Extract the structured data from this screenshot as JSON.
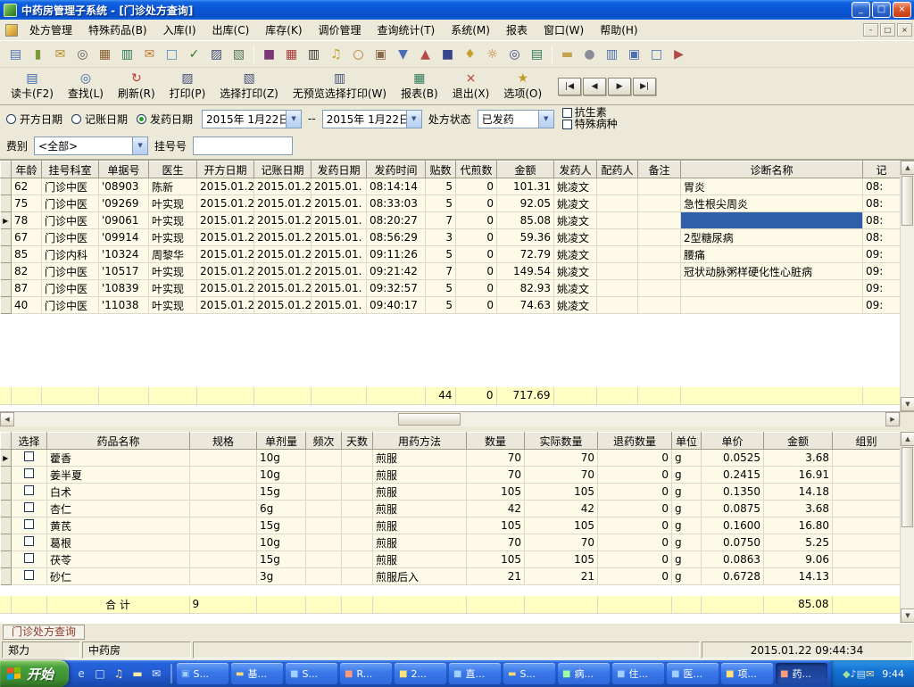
{
  "colors": {
    "titlebar_blue": "#0A56D8",
    "selection_blue": "#2E5FA8",
    "grid_row_bg": "#FDFBE7",
    "totals_row_bg": "#FFFFC4",
    "chrome_bg": "#ECE9D8",
    "taskbar_blue": "#2159CF",
    "start_green": "#3E8F33"
  },
  "window": {
    "title": "中药房管理子系统 - [门诊处方查询]",
    "controls": {
      "minimize": "_",
      "restore": "□",
      "close": "×"
    }
  },
  "menu": {
    "items": [
      "处方管理",
      "特殊药品(B)",
      "入库(I)",
      "出库(C)",
      "库存(K)",
      "调价管理",
      "查询统计(T)",
      "系统(M)",
      "报表",
      "窗口(W)",
      "帮助(H)"
    ],
    "mdi_controls": {
      "minimize": "–",
      "restore": "□",
      "close": "×"
    }
  },
  "toolbar1": [
    {
      "name": "card-scan",
      "glyph": "▤",
      "color": "#4A6FB5"
    },
    {
      "name": "medicine-vial",
      "glyph": "▮",
      "color": "#7A9A3A"
    },
    {
      "name": "mail-send",
      "glyph": "✉",
      "color": "#B5862A"
    },
    {
      "name": "binoculars",
      "glyph": "◎",
      "color": "#5A5A5A"
    },
    {
      "name": "abacus",
      "glyph": "▦",
      "color": "#8A5A2A"
    },
    {
      "name": "ledger-book",
      "glyph": "▥",
      "color": "#2E7A5A"
    },
    {
      "name": "mail-receive",
      "glyph": "✉",
      "color": "#C2762A"
    },
    {
      "name": "document-new",
      "glyph": "□",
      "color": "#4A8AC2"
    },
    {
      "name": "document-check",
      "glyph": "✓",
      "color": "#2A7A2A"
    },
    {
      "name": "printer",
      "glyph": "▨",
      "color": "#44507A"
    },
    {
      "name": "document-print",
      "glyph": "▧",
      "color": "#557755"
    },
    {
      "sep": true
    },
    {
      "name": "chart-report",
      "glyph": "■",
      "color": "#7A3A7A"
    },
    {
      "name": "calendar",
      "glyph": "▦",
      "color": "#AA3A3A"
    },
    {
      "name": "barcode",
      "glyph": "▥",
      "color": "#333333"
    },
    {
      "name": "alarm-bell",
      "glyph": "♫",
      "color": "#C2A22A"
    },
    {
      "name": "clock",
      "glyph": "○",
      "color": "#B5762A"
    },
    {
      "name": "medicine-box",
      "glyph": "▣",
      "color": "#8A6A4A"
    },
    {
      "name": "stock-in",
      "glyph": "▼",
      "color": "#4A6FB5"
    },
    {
      "name": "stock-out",
      "glyph": "▲",
      "color": "#B54A4A"
    },
    {
      "name": "save",
      "glyph": "■",
      "color": "#34458A"
    },
    {
      "name": "key",
      "glyph": "♦",
      "color": "#C2A22A"
    },
    {
      "name": "flashlight",
      "glyph": "☼",
      "color": "#C2762A"
    },
    {
      "name": "magnifier",
      "glyph": "◎",
      "color": "#34458A"
    },
    {
      "name": "checklist",
      "glyph": "▤",
      "color": "#2E7A5A"
    },
    {
      "sep": true
    },
    {
      "name": "folder-open",
      "glyph": "▬",
      "color": "#C2A24A"
    },
    {
      "name": "cd-disc",
      "glyph": "●",
      "color": "#8A8A98"
    },
    {
      "name": "window-tile",
      "glyph": "▥",
      "color": "#4A6FB5"
    },
    {
      "name": "window-cascade",
      "glyph": "▣",
      "color": "#4A6FB5"
    },
    {
      "name": "window-new",
      "glyph": "□",
      "color": "#4A6FB5"
    },
    {
      "name": "exit-app",
      "glyph": "▶",
      "color": "#B54A4A"
    }
  ],
  "toolbar2": {
    "buttons": [
      {
        "name": "read-card",
        "label": "读卡(F2)",
        "glyph": "▤",
        "color": "#3A66B0"
      },
      {
        "name": "find",
        "label": "查找(L)",
        "glyph": "◎",
        "color": "#3A66B0"
      },
      {
        "name": "refresh",
        "label": "刷新(R)",
        "glyph": "↻",
        "color": "#C03A2E"
      },
      {
        "name": "print",
        "label": "打印(P)",
        "glyph": "▨",
        "color": "#44507A"
      },
      {
        "name": "select-print",
        "label": "选择打印(Z)",
        "glyph": "▧",
        "color": "#44507A"
      },
      {
        "name": "no-preview-select-print",
        "label": "无预览选择打印(W)",
        "glyph": "▥",
        "color": "#44507A"
      },
      {
        "name": "report",
        "label": "报表(B)",
        "glyph": "▦",
        "color": "#2E7A5A"
      },
      {
        "name": "exit",
        "label": "退出(X)",
        "glyph": "×",
        "color": "#C03A2E"
      },
      {
        "name": "options",
        "label": "选项(O)",
        "glyph": "★",
        "color": "#C09A2E"
      }
    ],
    "nav": [
      {
        "name": "first-record",
        "glyph": "|◀"
      },
      {
        "name": "prev-record",
        "glyph": "◀"
      },
      {
        "name": "next-record",
        "glyph": "▶"
      },
      {
        "name": "last-record",
        "glyph": "▶|"
      }
    ]
  },
  "filters": {
    "radios": [
      {
        "label": "开方日期",
        "selected": false
      },
      {
        "label": "记账日期",
        "selected": false
      },
      {
        "label": "发药日期",
        "selected": true
      }
    ],
    "date_from": "2015年 1月22日",
    "range_separator": "--",
    "date_to": "2015年 1月22日",
    "status_label": "处方状态",
    "status_value": "已发药",
    "checkbox_antibiotic": "抗生素",
    "checkbox_special": "特殊病种",
    "fee_label": "费别",
    "fee_value": "<全部>",
    "reg_label": "挂号号",
    "reg_value": ""
  },
  "main_table": {
    "columns": [
      "年龄",
      "挂号科室",
      "单据号",
      "医生",
      "开方日期",
      "记账日期",
      "发药日期",
      "发药时间",
      "贴数",
      "代煎数",
      "金额",
      "发药人",
      "配药人",
      "备注",
      "诊断名称",
      "记"
    ],
    "rows": [
      [
        "62",
        "门诊中医",
        "'08903",
        "陈新",
        "2015.01.2",
        "2015.01.2",
        "2015.01.",
        "08:14:14",
        "5",
        "0",
        "101.31",
        "姚凌文",
        "",
        "",
        "胃炎",
        "08:"
      ],
      [
        "75",
        "门诊中医",
        "'09269",
        "叶实现",
        "2015.01.2",
        "2015.01.2",
        "2015.01.",
        "08:33:03",
        "5",
        "0",
        "92.05",
        "姚凌文",
        "",
        "",
        "急性根尖周炎",
        "08:"
      ],
      [
        "78",
        "门诊中医",
        "'09061",
        "叶实现",
        "2015.01.2",
        "2015.01.2",
        "2015.01.",
        "08:20:27",
        "7",
        "0",
        "85.08",
        "姚凌文",
        "",
        "",
        "",
        "08:"
      ],
      [
        "67",
        "门诊中医",
        "'09914",
        "叶实现",
        "2015.01.2",
        "2015.01.2",
        "2015.01.",
        "08:56:29",
        "3",
        "0",
        "59.36",
        "姚凌文",
        "",
        "",
        "2型糖尿病",
        "08:"
      ],
      [
        "85",
        "门诊内科",
        "'10324",
        "周黎华",
        "2015.01.2",
        "2015.01.2",
        "2015.01.",
        "09:11:26",
        "5",
        "0",
        "72.79",
        "姚凌文",
        "",
        "",
        "腰痛",
        "09:"
      ],
      [
        "82",
        "门诊中医",
        "'10517",
        "叶实现",
        "2015.01.2",
        "2015.01.2",
        "2015.01.",
        "09:21:42",
        "7",
        "0",
        "149.54",
        "姚凌文",
        "",
        "",
        "冠状动脉粥样硬化性心脏病",
        "09:"
      ],
      [
        "87",
        "门诊中医",
        "'10839",
        "叶实现",
        "2015.01.2",
        "2015.01.2",
        "2015.01.",
        "09:32:57",
        "5",
        "0",
        "82.93",
        "姚凌文",
        "",
        "",
        "",
        "09:"
      ],
      [
        "40",
        "门诊中医",
        "'11038",
        "叶实现",
        "2015.01.2",
        "2015.01.2",
        "2015.01.",
        "09:40:17",
        "5",
        "0",
        "74.63",
        "姚凌文",
        "",
        "",
        "",
        "09:"
      ]
    ],
    "totals": {
      "tie_count": "44",
      "daijian_count": "0",
      "amount": "717.69"
    }
  },
  "detail_table": {
    "columns": [
      "选择",
      "药品名称",
      "规格",
      "单剂量",
      "频次",
      "天数",
      "用药方法",
      "数量",
      "实际数量",
      "退药数量",
      "单位",
      "单价",
      "金额",
      "组别"
    ],
    "rows": [
      [
        "",
        "藿香",
        "",
        "10g",
        "",
        "",
        "煎服",
        "70",
        "70",
        "0",
        "g",
        "0.0525",
        "3.68",
        ""
      ],
      [
        "",
        "姜半夏",
        "",
        "10g",
        "",
        "",
        "煎服",
        "70",
        "70",
        "0",
        "g",
        "0.2415",
        "16.91",
        ""
      ],
      [
        "",
        "白术",
        "",
        "15g",
        "",
        "",
        "煎服",
        "105",
        "105",
        "0",
        "g",
        "0.1350",
        "14.18",
        ""
      ],
      [
        "",
        "杏仁",
        "",
        "6g",
        "",
        "",
        "煎服",
        "42",
        "42",
        "0",
        "g",
        "0.0875",
        "3.68",
        ""
      ],
      [
        "",
        "黄芪",
        "",
        "15g",
        "",
        "",
        "煎服",
        "105",
        "105",
        "0",
        "g",
        "0.1600",
        "16.80",
        ""
      ],
      [
        "",
        "葛根",
        "",
        "10g",
        "",
        "",
        "煎服",
        "70",
        "70",
        "0",
        "g",
        "0.0750",
        "5.25",
        ""
      ],
      [
        "",
        "茯苓",
        "",
        "15g",
        "",
        "",
        "煎服",
        "105",
        "105",
        "0",
        "g",
        "0.0863",
        "9.06",
        ""
      ],
      [
        "",
        "砂仁",
        "",
        "3g",
        "",
        "",
        "煎服后入",
        "21",
        "21",
        "0",
        "g",
        "0.6728",
        "14.13",
        ""
      ]
    ],
    "total": {
      "label": "合  计",
      "dose_total": "9",
      "amount": "85.08"
    }
  },
  "doc_tab": "门诊处方查询",
  "statusbar": {
    "user": "郑力",
    "department": "中药房",
    "middle": "",
    "datetime": "2015.01.22 09:44:34"
  },
  "taskbar": {
    "start_label": "开始",
    "quick_launch": [
      {
        "name": "internet-explorer",
        "glyph": "e",
        "color": "#BFE3FF"
      },
      {
        "name": "show-desktop",
        "glyph": "□",
        "color": "#D8E8FF"
      },
      {
        "name": "media-player",
        "glyph": "♫",
        "color": "#FFD9A0"
      },
      {
        "name": "folder-docs",
        "glyph": "▬",
        "color": "#FFE9A0"
      },
      {
        "name": "mail",
        "glyph": "✉",
        "color": "#E8F0FF"
      }
    ],
    "tasks": [
      {
        "label": "S...",
        "glyph": "▣",
        "color": "#9FD0FF",
        "active": false
      },
      {
        "label": "基...",
        "glyph": "▬",
        "color": "#FFD97A",
        "active": false
      },
      {
        "label": "S...",
        "glyph": "■",
        "color": "#9FD0FF",
        "active": false
      },
      {
        "label": "R...",
        "glyph": "■",
        "color": "#FF9A7A",
        "active": false
      },
      {
        "label": "2...",
        "glyph": "■",
        "color": "#FFE07A",
        "active": false
      },
      {
        "label": "直...",
        "glyph": "■",
        "color": "#9FD0FF",
        "active": false
      },
      {
        "label": "S...",
        "glyph": "▬",
        "color": "#FFD97A",
        "active": false
      },
      {
        "label": "病...",
        "glyph": "■",
        "color": "#9FFFA0",
        "active": false
      },
      {
        "label": "住...",
        "glyph": "■",
        "color": "#9FD0FF",
        "active": false
      },
      {
        "label": "医...",
        "glyph": "■",
        "color": "#9FD0FF",
        "active": false
      },
      {
        "label": "项...",
        "glyph": "■",
        "color": "#FFE07A",
        "active": false
      },
      {
        "label": "药...",
        "glyph": "■",
        "color": "#FF9A7A",
        "active": true
      }
    ],
    "tray_icons": [
      {
        "name": "antivirus-shield",
        "glyph": "◆",
        "color": "#9FE09F"
      },
      {
        "name": "volume",
        "glyph": "♪",
        "color": "#E8F0FF"
      },
      {
        "name": "network",
        "glyph": "▤",
        "color": "#BFE3FF"
      },
      {
        "name": "message",
        "glyph": "✉",
        "color": "#FFE9A0"
      }
    ],
    "clock": "9:44"
  }
}
